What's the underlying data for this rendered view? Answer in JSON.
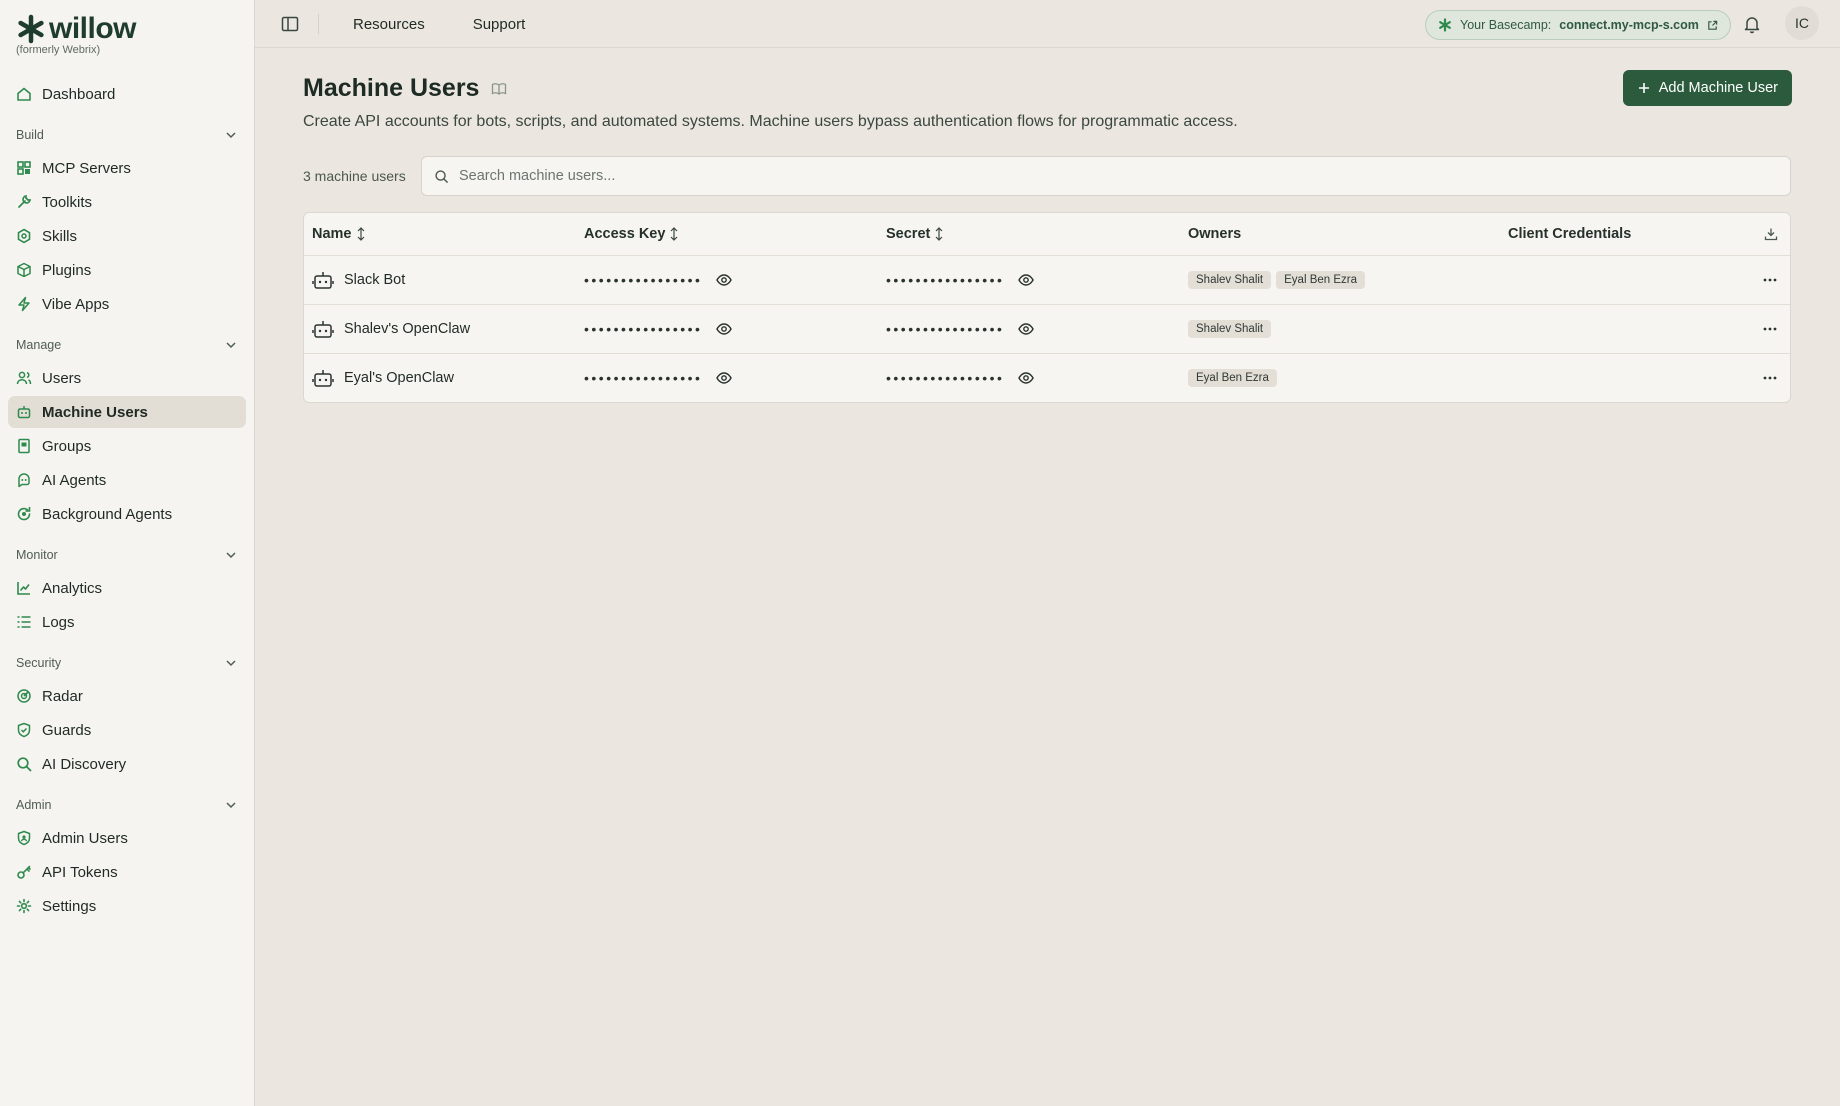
{
  "brand": {
    "name": "willow",
    "subtitle": "(formerly Webrix)"
  },
  "sidebar": {
    "top": [
      {
        "label": "Dashboard",
        "icon": "home-icon"
      }
    ],
    "sections": [
      {
        "title": "Build",
        "items": [
          {
            "label": "MCP Servers",
            "icon": "servers-icon"
          },
          {
            "label": "Toolkits",
            "icon": "wrench-icon"
          },
          {
            "label": "Skills",
            "icon": "hexagon-icon"
          },
          {
            "label": "Plugins",
            "icon": "package-icon"
          },
          {
            "label": "Vibe Apps",
            "icon": "bolt-icon"
          }
        ]
      },
      {
        "title": "Manage",
        "items": [
          {
            "label": "Users",
            "icon": "users-icon"
          },
          {
            "label": "Machine Users",
            "icon": "robot-icon",
            "active": true
          },
          {
            "label": "Groups",
            "icon": "book-icon"
          },
          {
            "label": "AI Agents",
            "icon": "bot-icon"
          },
          {
            "label": "Background Agents",
            "icon": "refresh-icon"
          }
        ]
      },
      {
        "title": "Monitor",
        "items": [
          {
            "label": "Analytics",
            "icon": "chart-icon"
          },
          {
            "label": "Logs",
            "icon": "list-icon"
          }
        ]
      },
      {
        "title": "Security",
        "items": [
          {
            "label": "Radar",
            "icon": "radar-icon"
          },
          {
            "label": "Guards",
            "icon": "shield-icon"
          },
          {
            "label": "AI Discovery",
            "icon": "search-icon"
          }
        ]
      },
      {
        "title": "Admin",
        "items": [
          {
            "label": "Admin Users",
            "icon": "shield-user-icon"
          },
          {
            "label": "API Tokens",
            "icon": "key-icon"
          },
          {
            "label": "Settings",
            "icon": "gear-icon"
          }
        ]
      }
    ]
  },
  "topbar": {
    "links": [
      "Resources",
      "Support"
    ],
    "basecamp_label": "Your Basecamp:",
    "basecamp_url": "connect.my-mcp-s.com",
    "avatar_initials": "IC"
  },
  "page": {
    "title": "Machine Users",
    "description": "Create API accounts for bots, scripts, and automated systems. Machine users bypass authentication flows for programmatic access.",
    "add_button": "Add Machine User",
    "count_text": "3 machine users",
    "search_placeholder": "Search machine users..."
  },
  "table": {
    "columns": {
      "name": "Name",
      "access_key": "Access Key",
      "secret": "Secret",
      "owners": "Owners",
      "credentials": "Client Credentials"
    },
    "masked": "••••••••••••••••",
    "rows": [
      {
        "name": "Slack Bot",
        "owners": [
          "Shalev Shalit",
          "Eyal Ben Ezra"
        ]
      },
      {
        "name": "Shalev's OpenClaw",
        "owners": [
          "Shalev Shalit"
        ]
      },
      {
        "name": "Eyal's OpenClaw",
        "owners": [
          "Eyal Ben Ezra"
        ]
      }
    ]
  },
  "colors": {
    "accent": "#2b5b3c",
    "background": "#ebe7e0",
    "sidebar": "#f6f4f0",
    "icon_green": "#2f8a4e"
  }
}
